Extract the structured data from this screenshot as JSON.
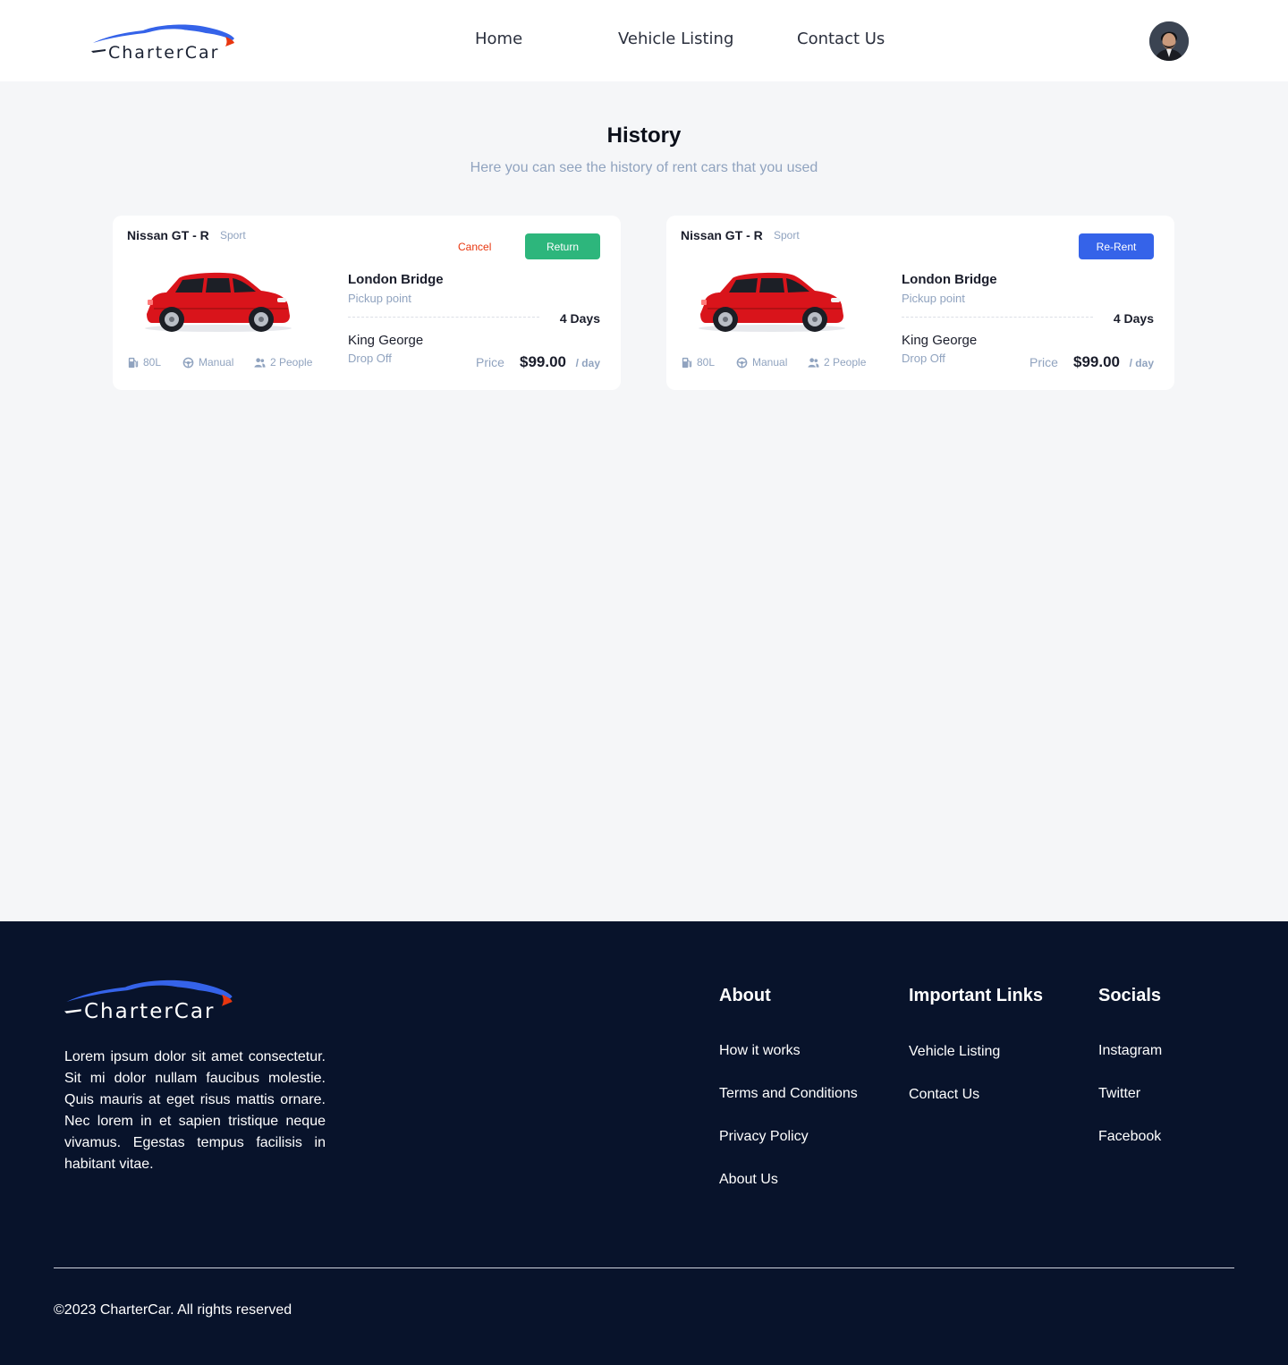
{
  "brand": {
    "name": "CharterCar",
    "colors": {
      "primary": "#3563e9",
      "accent": "#e8360f",
      "dark": "#08132b",
      "muted": "#90a3bf",
      "success": "#2db67c"
    }
  },
  "nav": {
    "links": [
      "Home",
      "Vehicle Listing",
      "Contact Us"
    ]
  },
  "history": {
    "title": "History",
    "subtitle": "Here you can see the history of rent cars that you used"
  },
  "cards": [
    {
      "name": "Nissan GT - R",
      "type": "Sport",
      "pickup": {
        "name": "London Bridge",
        "label": "Pickup point"
      },
      "dropoff": {
        "name": "King George",
        "label": "Drop Off"
      },
      "duration": "4 Days",
      "specs": {
        "fuel": "80L",
        "transmission": "Manual",
        "capacity": "2 People"
      },
      "price_label": "Price",
      "price": "$99.00",
      "per": "/ day",
      "cancel_label": "Cancel",
      "action_label": "Return",
      "action_color": "#2db67c"
    },
    {
      "name": "Nissan GT - R",
      "type": "Sport",
      "pickup": {
        "name": "London Bridge",
        "label": "Pickup point"
      },
      "dropoff": {
        "name": "King George",
        "label": "Drop Off"
      },
      "duration": "4 Days",
      "specs": {
        "fuel": "80L",
        "transmission": "Manual",
        "capacity": "2 People"
      },
      "price_label": "Price",
      "price": "$99.00",
      "per": "/ day",
      "action_label": "Re-Rent",
      "action_color": "#3563e9"
    }
  ],
  "footer": {
    "description": "Lorem ipsum dolor sit amet consectetur. Sit mi dolor nullam faucibus molestie. Quis mauris at eget risus mattis ornare. Nec lorem in et sapien tristique neque vivamus. Egestas tempus facilisis in habitant vitae.",
    "about": {
      "title": "About",
      "links": [
        "How it works",
        "Terms and Conditions",
        "Privacy Policy",
        "About Us"
      ]
    },
    "important": {
      "title": "Important Links",
      "links": [
        "Vehicle Listing",
        "Contact Us"
      ]
    },
    "socials": {
      "title": "Socials",
      "links": [
        "Instagram",
        "Twitter",
        "Facebook"
      ]
    },
    "copyright": "©2023 CharterCar. All rights reserved"
  },
  "icons": [
    "fuel-icon",
    "steering-wheel-icon",
    "people-icon"
  ]
}
